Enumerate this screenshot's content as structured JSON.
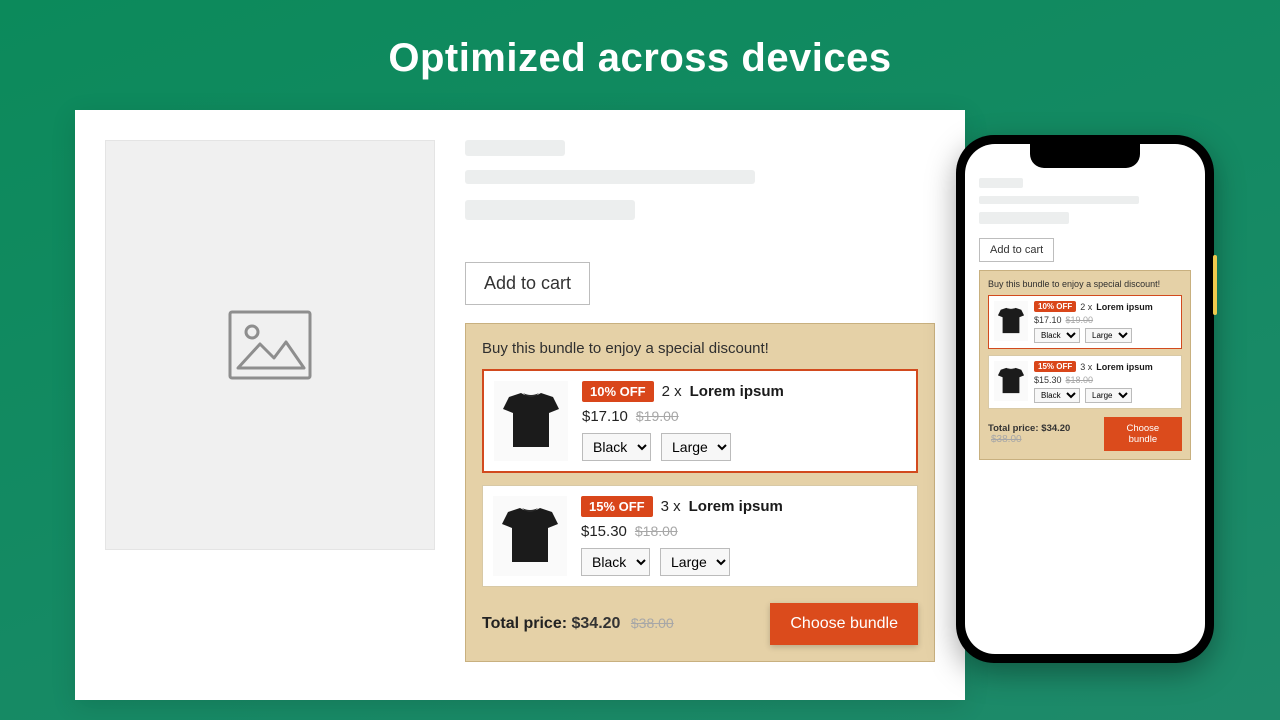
{
  "headline": "Optimized across devices",
  "add_to_cart_label": "Add to cart",
  "bundle": {
    "title": "Buy this bundle to enjoy a special discount!",
    "rows": [
      {
        "discount_badge": "10% OFF",
        "qty_text": "2 x",
        "product_name": "Lorem ipsum",
        "price": "$17.10",
        "original_price": "$19.00",
        "option_color": "Black",
        "option_size": "Large"
      },
      {
        "discount_badge": "15% OFF",
        "qty_text": "3 x",
        "product_name": "Lorem ipsum",
        "price": "$15.30",
        "original_price": "$18.00",
        "option_color": "Black",
        "option_size": "Large"
      }
    ],
    "total_label": "Total price:",
    "total_price": "$34.20",
    "total_original": "$38.00",
    "choose_label": "Choose bundle"
  },
  "phone": {
    "add_to_cart_label": "Add to cart",
    "bundle_title": "Buy this bundle to enjoy a special discount!",
    "rows": [
      {
        "discount_badge": "10% OFF",
        "qty_text": "2 x",
        "product_name": "Lorem ipsum",
        "price": "$17.10",
        "original_price": "$19.00",
        "option_color": "Black",
        "option_size": "Large"
      },
      {
        "discount_badge": "15% OFF",
        "qty_text": "3 x",
        "product_name": "Lorem ipsum",
        "price": "$15.30",
        "original_price": "$18.00",
        "option_color": "Black",
        "option_size": "Large"
      }
    ],
    "total_label": "Total price:",
    "total_price": "$34.20",
    "total_original": "$38.00",
    "choose_label": "Choose bundle"
  }
}
